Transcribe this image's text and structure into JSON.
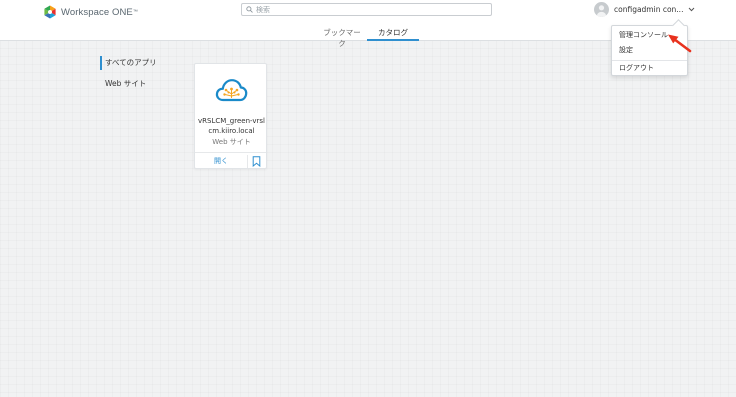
{
  "header": {
    "brand_name": "Workspace ONE",
    "brand_tm": "™",
    "search_placeholder": "検索",
    "user_name": "configadmin con...",
    "icons": {
      "logo": "workspace-one-logo",
      "search": "search-icon",
      "avatar": "user-avatar",
      "chevron": "chevron-down-icon"
    }
  },
  "tabs": [
    {
      "label": "ブックマーク",
      "active": false
    },
    {
      "label": "カタログ",
      "active": true
    }
  ],
  "sidebar": {
    "items": [
      {
        "label": "すべてのアプリ",
        "active": true
      },
      {
        "label": "Web サイト",
        "active": false
      }
    ]
  },
  "app_card": {
    "name": "vRSLCM_green-vrslcm.kiiro.local",
    "type": "Web サイト",
    "open_label": "開く",
    "icons": {
      "app": "cloud-app-icon",
      "bookmark": "bookmark-icon"
    }
  },
  "user_menu": {
    "items": [
      {
        "label": "管理コンソール"
      },
      {
        "label": "設定"
      },
      {
        "label": "ログアウト"
      }
    ]
  },
  "colors": {
    "accent": "#2f8fcf",
    "annotation_arrow": "#e8321e",
    "app_icon": "#1a8ac9",
    "app_icon_nodes": "#f5a623"
  }
}
